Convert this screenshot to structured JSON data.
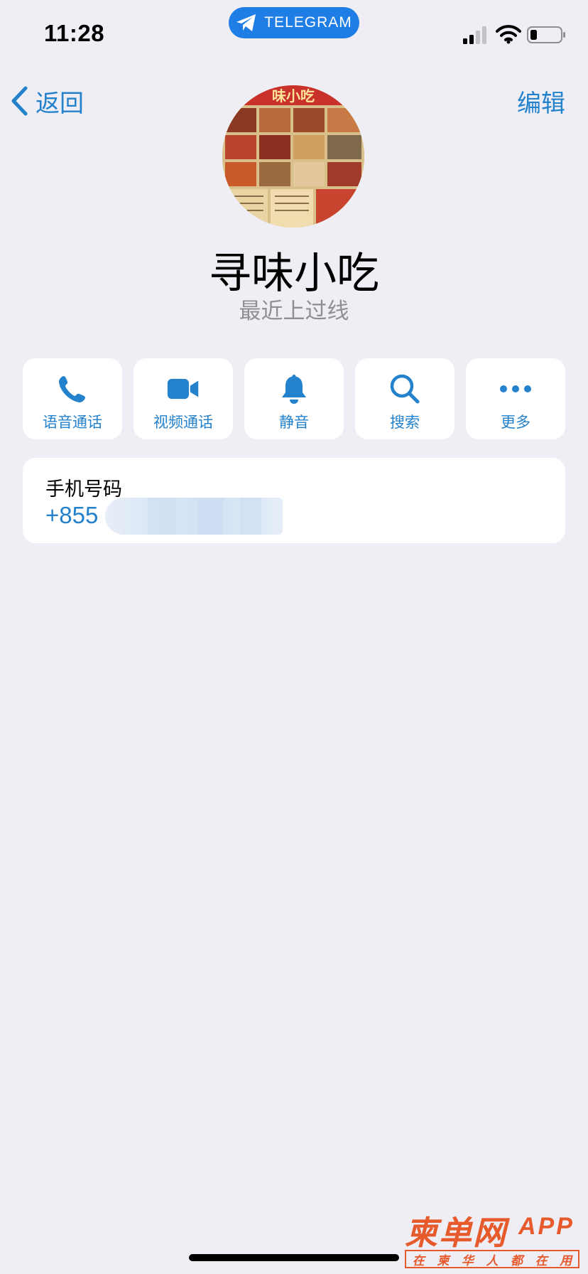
{
  "status_bar": {
    "time": "11:28",
    "app_pill_label": "TELEGRAM",
    "signal_icon": "cellular-signal-icon",
    "wifi_icon": "wifi-icon",
    "battery_icon": "battery-low-icon",
    "battery_level": 0.2
  },
  "nav": {
    "back_label": "返回",
    "edit_label": "编辑"
  },
  "profile": {
    "name": "寻味小吃",
    "status": "最近上过线",
    "avatar_banner_text": "味小吃"
  },
  "actions": [
    {
      "label": "语音通话",
      "icon": "phone-icon"
    },
    {
      "label": "视频通话",
      "icon": "video-camera-icon"
    },
    {
      "label": "静音",
      "icon": "bell-icon"
    },
    {
      "label": "搜索",
      "icon": "search-icon"
    },
    {
      "label": "更多",
      "icon": "more-dots-icon"
    }
  ],
  "info": {
    "phone_label": "手机号码",
    "phone_value": "+855"
  },
  "watermark": {
    "brand": "柬单网",
    "app": "APP",
    "slogan": [
      "在",
      "柬",
      "华",
      "人",
      "都",
      "在",
      "用"
    ]
  },
  "colors": {
    "background": "#efeef4",
    "accent": "#2481cc",
    "pill": "#1f7de6",
    "watermark": "#e65a2c"
  }
}
